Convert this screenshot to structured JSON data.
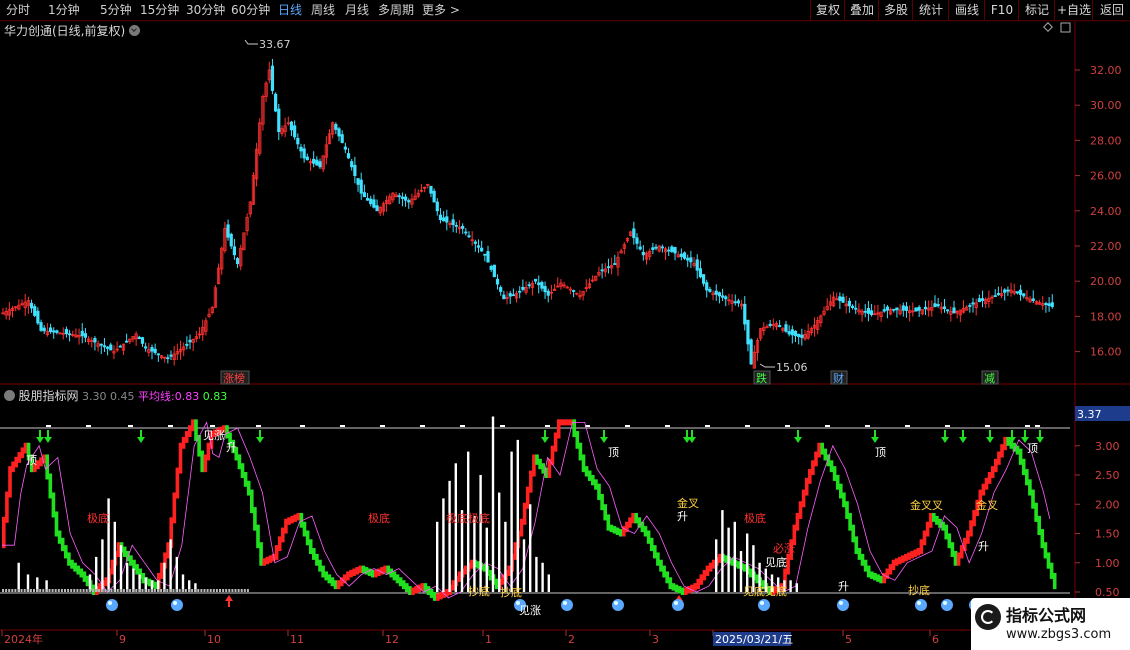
{
  "toolbar": {
    "left_items": [
      "分时",
      "1分钟",
      "5分钟",
      "15分钟",
      "30分钟",
      "60分钟",
      "日线",
      "周线",
      "月线",
      "多周期",
      "更多 >"
    ],
    "active": "日线",
    "right_items": [
      "复权",
      "叠加",
      "多股",
      "统计",
      "画线",
      "F10",
      "标记",
      "+自选",
      "返回"
    ]
  },
  "stock_title": "华力创通(日线,前复权)",
  "price_axis": [
    "32.00",
    "30.00",
    "28.00",
    "26.00",
    "24.00",
    "22.00",
    "20.00",
    "18.00",
    "16.00"
  ],
  "annotations": {
    "high": "33.67",
    "low": "15.06"
  },
  "event_tags": [
    "涨榜",
    "跌",
    "财",
    "减"
  ],
  "indicator": {
    "name": "股朋指标网",
    "v1": "3.30",
    "v2": "0.45",
    "avg_label": "平均线:",
    "avg1": "0.83",
    "avg2": "0.83",
    "axis": [
      "3.00",
      "2.50",
      "2.00",
      "1.50",
      "1.00",
      "0.50"
    ],
    "current_value": "3.37"
  },
  "signal_labels": [
    "顶",
    "见涨",
    "升",
    "极底",
    "极底",
    "极底极底",
    "顶",
    "金叉",
    "升",
    "极底",
    "必涨",
    "见底",
    "见底见底",
    "升",
    "顶",
    "金叉叉",
    "金叉",
    "升",
    "顶",
    "抄底",
    "抄底",
    "抄底",
    "见涨"
  ],
  "date_axis": [
    "2024年",
    "9",
    "10",
    "11",
    "12",
    "1",
    "2",
    "3",
    "2025/03/21/五",
    "5",
    "6"
  ],
  "colors": {
    "up": "#ff2020",
    "down": "#20e020",
    "accent": "#5aa8ff",
    "avg": "#ff40ff",
    "border": "#7a0000",
    "cyan": "#40e0ff"
  },
  "logo": {
    "title": "指标公式网",
    "url": "www.zbgs3.com"
  }
}
